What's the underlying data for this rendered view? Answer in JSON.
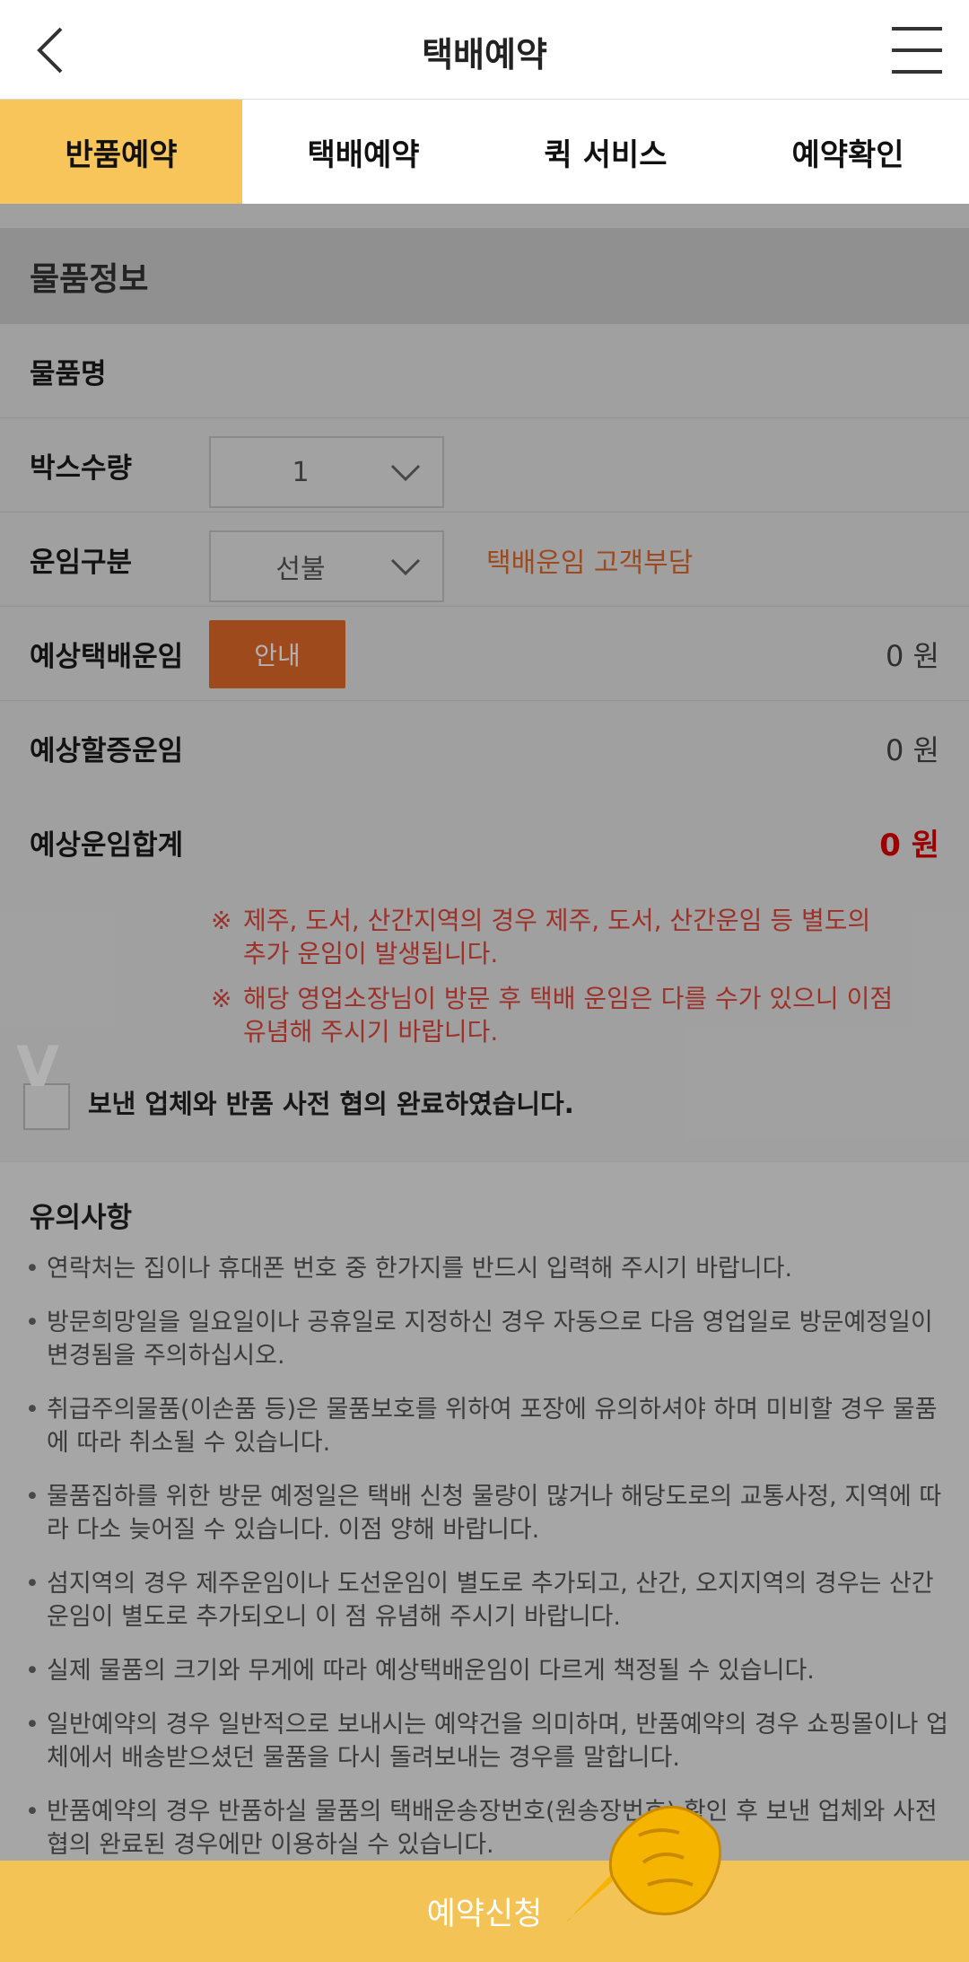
{
  "header": {
    "title": "택배예약"
  },
  "tabs": [
    {
      "label": "반품예약",
      "active": true
    },
    {
      "label": "택배예약",
      "active": false
    },
    {
      "label": "퀵 서비스",
      "active": false
    },
    {
      "label": "예약확인",
      "active": false
    }
  ],
  "item_info": {
    "section_title": "물품정보",
    "item_name_label": "물품명",
    "box_count_label": "박스수량",
    "box_count_value": "1",
    "fare_type_label": "운임구분",
    "fare_type_value": "선불",
    "fare_type_note": "택배운임 고객부담",
    "est_fare_label": "예상택배운임",
    "guide_button": "안내",
    "est_fare_value": "0 원",
    "est_surcharge_label": "예상할증운임",
    "est_surcharge_value": "0 원",
    "est_total_label": "예상운임합계",
    "est_total_value": "0 원"
  },
  "warnings": [
    {
      "mark": "※",
      "line1": "제주, 도서, 산간지역의 경우 제주, 도서, 산간운임 등 별도의",
      "line2": "추가 운임이 발생됩니다."
    },
    {
      "mark": "※",
      "line1": "해당 영업소장님이 방문 후 택배 운임은 다를 수가 있으니 이점",
      "line2": "유념해 주시기 바랍니다."
    }
  ],
  "agreement": {
    "check_mark": "V",
    "label": "보낸 업체와 반품 사전 협의 완료하였습니다."
  },
  "notice": {
    "title": "유의사항",
    "items": [
      "연락처는 집이나 휴대폰 번호 중 한가지를 반드시 입력해 주시기 바랍니다.",
      "방문희망일을 일요일이나 공휴일로 지정하신 경우 자동으로 다음 영업일로 방문예정일이 변경됨을 주의하십시오.",
      "취급주의물품(이손품 등)은 물품보호를 위하여 포장에 유의하셔야 하며 미비할 경우 물품에 따라 취소될 수 있습니다.",
      "물품집하를 위한 방문 예정일은 택배 신청 물량이 많거나 해당도로의 교통사정, 지역에 따라 다소 늦어질 수 있습니다. 이점 양해 바랍니다.",
      "섬지역의 경우 제주운임이나 도선운임이 별도로 추가되고, 산간, 오지지역의 경우는 산간운임이 별도로 추가되오니 이 점 유념해 주시기 바랍니다.",
      "실제 물품의 크기와 무게에 따라 예상택배운임이 다르게 책정될 수 있습니다.",
      "일반예약의 경우 일반적으로 보내시는 예약건을 의미하며, 반품예약의 경우 쇼핑몰이나 업체에서 배송받으셨던 물품을 다시 돌려보내는 경우를 말합니다.",
      "반품예약의 경우 반품하실 물품의 택배운송장번호(원송장번호) 확인 후 보낸 업체와 사전 협의 완료된 경우에만 이용하실 수 있습니다."
    ]
  },
  "submit_label": "예약신청",
  "colors": {
    "accent": "#f7c55a",
    "orange": "#e36b29",
    "red": "#e00000"
  }
}
